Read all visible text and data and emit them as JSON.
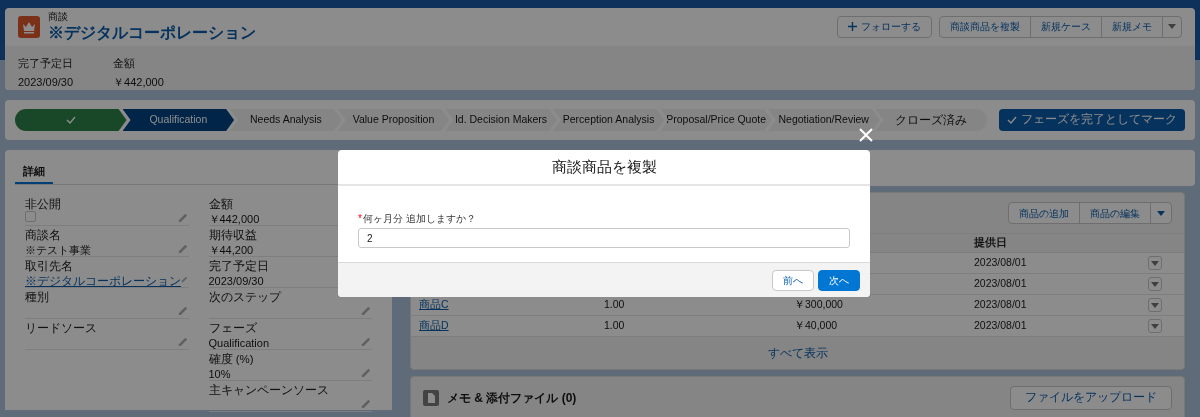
{
  "record": {
    "type_label": "商談",
    "title": "※デジタルコーポレーション",
    "actions": [
      {
        "label": "フォローする",
        "kind": "follow"
      },
      {
        "label": "商談商品を複製",
        "kind": "plain"
      },
      {
        "label": "新規ケース",
        "kind": "plain"
      },
      {
        "label": "新規メモ",
        "kind": "plain"
      },
      {
        "kind": "menu"
      }
    ],
    "highlights": [
      {
        "label": "完了予定日",
        "value": "2023/09/30"
      },
      {
        "label": "金額",
        "value": "￥442,000"
      }
    ]
  },
  "path": {
    "stages": [
      {
        "completed": true,
        "selected": false
      },
      {
        "label": "Qualification",
        "completed": false,
        "selected": true
      },
      {
        "label": "Needs Analysis",
        "completed": false,
        "selected": false
      },
      {
        "label": "Value Proposition",
        "completed": false,
        "selected": false
      },
      {
        "label": "Id. Decision Makers",
        "completed": false,
        "selected": false
      },
      {
        "label": "Perception Analysis",
        "completed": false,
        "selected": false
      },
      {
        "label": "Proposal/Price Quote",
        "completed": false,
        "selected": false
      },
      {
        "label": "Negotiation/Review",
        "completed": false,
        "selected": false
      },
      {
        "label": "クローズ済み",
        "completed": false,
        "selected": false
      }
    ],
    "mark_button": "フェーズを完了としてマーク"
  },
  "details": {
    "tabs": [
      {
        "label": "詳細",
        "selected": true
      }
    ],
    "columns": [
      [
        {
          "label": "非公開",
          "kind": "checkbox",
          "checked": false
        },
        {
          "label": "商談名",
          "kind": "text",
          "value": "※テスト事業"
        },
        {
          "label": "取引先名",
          "kind": "link",
          "value": "※デジタルコーポレーション"
        },
        {
          "label": "種別",
          "kind": "text"
        },
        {
          "label": "リードソース",
          "kind": "text"
        }
      ],
      [
        {
          "label": "金額",
          "kind": "text",
          "value": "￥442,000"
        },
        {
          "label": "期待収益",
          "kind": "text",
          "value": "￥44,200"
        },
        {
          "label": "完了予定日",
          "kind": "text",
          "value": "2023/09/30"
        },
        {
          "label": "次のステップ",
          "kind": "text"
        },
        {
          "label": "フェーズ",
          "kind": "text",
          "value": "Qualification"
        },
        {
          "label": "確度 (%)",
          "kind": "text",
          "value": "10%"
        },
        {
          "label": "主キャンペーンソース",
          "kind": "text"
        }
      ]
    ]
  },
  "products": {
    "buttons": [
      "商品の追加",
      "商品の編集"
    ],
    "columns": [
      {
        "label": "提供日"
      }
    ],
    "rows": [
      {
        "date": "2023/08/01"
      },
      {
        "date": "2023/08/01"
      },
      {
        "name": "商品C",
        "quantity": "1.00",
        "price": "￥300,000",
        "date": "2023/08/01"
      },
      {
        "name": "商品D",
        "quantity": "1.00",
        "price": "￥40,000",
        "date": "2023/08/01"
      }
    ],
    "view_all": "すべて表示"
  },
  "notes": {
    "title": "メモ & 添付ファイル (0)",
    "upload_button": "ファイルをアップロード"
  },
  "modal": {
    "title": "商談商品を複製",
    "field": {
      "required_mark": "*",
      "label": "何ヶ月分 追加しますか？",
      "value": "2"
    },
    "buttons": [
      {
        "label": "前へ",
        "kind": "neutral"
      },
      {
        "label": "次へ",
        "kind": "brand"
      }
    ]
  }
}
